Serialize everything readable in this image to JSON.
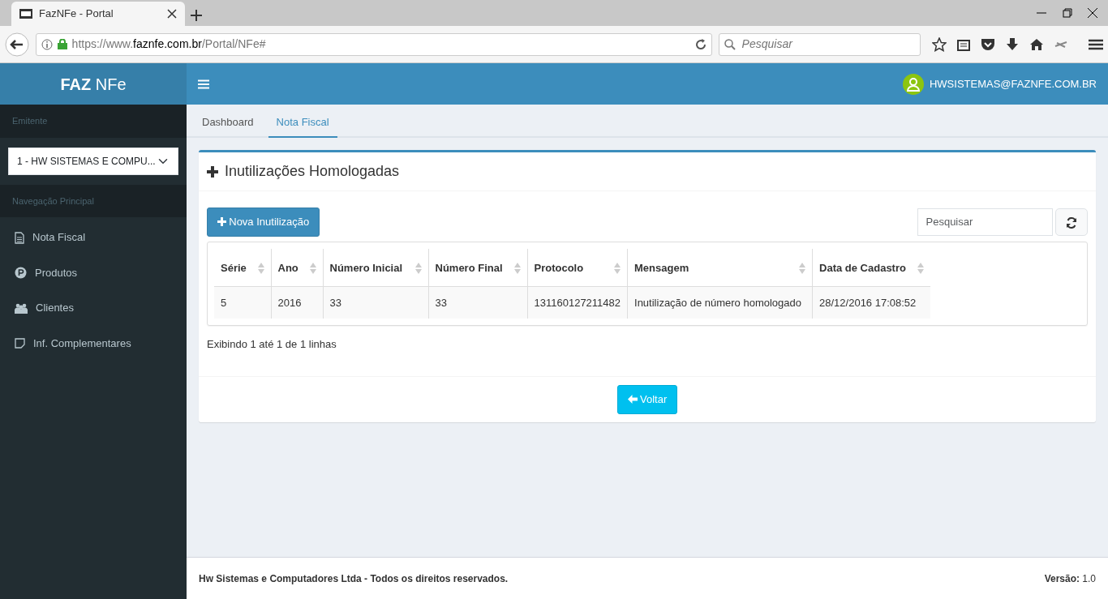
{
  "browser": {
    "tab_title": "FazNFe - Portal",
    "url_host": "https://www.faznfe.com.br",
    "url_path": "/Portal/NFe#",
    "search_placeholder": "Pesquisar"
  },
  "header": {
    "logo": "**FAZ** NFe",
    "user": "HWSISTEMAS@FAZNFE.COM.BR"
  },
  "sidebar": {
    "emitente_label": "Emitente",
    "emitente_value": "1 - HW SISTEMAS E COMPU...",
    "nav_heading": "Navegação Principal",
    "items": [
      {
        "label": "Nota Fiscal",
        "kind": "document"
      },
      {
        "label": "Produtos",
        "kind": "product"
      },
      {
        "label": "Clientes",
        "kind": "people"
      },
      {
        "label": "Inf. Complementares",
        "kind": "note"
      }
    ]
  },
  "tabs": [
    {
      "label": "Dashboard",
      "selected": false
    },
    {
      "label": "Nota Fiscal",
      "selected": true
    }
  ],
  "panel": {
    "title": "Inutilizações Homologadas",
    "new_button": "Nova Inutilização",
    "search_placeholder": "Pesquisar",
    "table": {
      "columns": [
        "Série",
        "Ano",
        "Número Inicial",
        "Número Final",
        "Protocolo",
        "Mensagem",
        "Data de Cadastro"
      ],
      "rows": [
        [
          "5",
          "2016",
          "33",
          "33",
          "131160127211482",
          "Inutilização de número homologado",
          "28/12/2016 17:08:52"
        ]
      ]
    },
    "summary": "Exibindo 1 até 1 de 1 linhas",
    "back_button": "Voltar"
  },
  "footer": {
    "copyright": "Hw Sistemas e Computadores Ltda - Todos os direitos reservados.",
    "version": "**Versão:** 1.0"
  }
}
